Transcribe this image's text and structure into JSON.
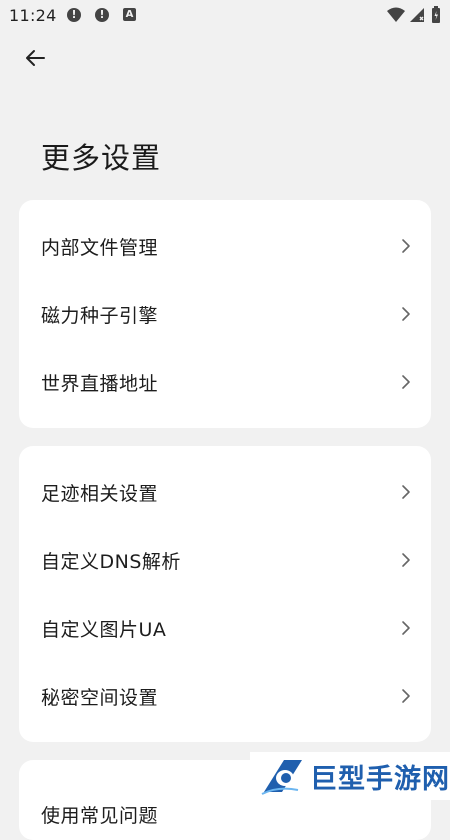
{
  "status_bar": {
    "time": "11:24",
    "notif_a": "A"
  },
  "header": {
    "title": "更多设置"
  },
  "cards": [
    {
      "items": [
        {
          "label": "内部文件管理"
        },
        {
          "label": "磁力种子引擎"
        },
        {
          "label": "世界直播地址"
        }
      ]
    },
    {
      "items": [
        {
          "label": "足迹相关设置"
        },
        {
          "label": "自定义DNS解析"
        },
        {
          "label": "自定义图片UA"
        },
        {
          "label": "秘密空间设置"
        }
      ]
    },
    {
      "items": [
        {
          "label": "使用常见问题"
        }
      ]
    }
  ],
  "watermark": {
    "text": "巨型手游网"
  },
  "colors": {
    "background": "#f1f1f1",
    "card": "#ffffff",
    "watermark_blue": "#1f5fae"
  }
}
